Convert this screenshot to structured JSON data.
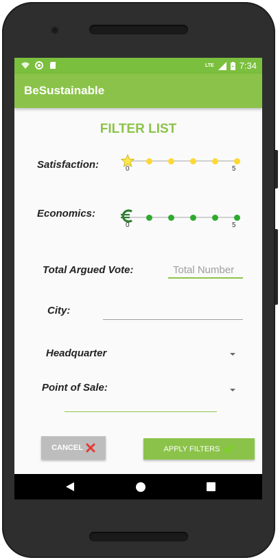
{
  "status_bar": {
    "network_label": "LTE",
    "time": "7:34"
  },
  "app_bar": {
    "title": "BeSustainable"
  },
  "filter": {
    "heading": "FILTER LIST",
    "satisfaction": {
      "label": "Satisfaction:",
      "min_label": "0",
      "max_label": "5",
      "value": 0,
      "steps": 6,
      "thumb_icon": "star-icon",
      "dot_color": "#fdd835"
    },
    "economics": {
      "label": "Economics:",
      "min_label": "0",
      "max_label": "5",
      "value": 0,
      "steps": 6,
      "thumb_icon": "euro-icon",
      "dot_color": "#2eaa2e"
    },
    "total_argued_vote": {
      "label": "Total Argued Vote:",
      "placeholder": "Total Number",
      "value": ""
    },
    "city": {
      "label": "City:",
      "value": ""
    },
    "headquarter": {
      "label": "Headquarter",
      "selected": ""
    },
    "point_of_sale": {
      "label": "Point of Sale:",
      "selected": ""
    }
  },
  "buttons": {
    "cancel_label": "CANCEL",
    "cancel_icon": "cross-icon",
    "apply_label": "APPLY FILTERS",
    "apply_icon": "check-icon"
  },
  "colors": {
    "primary": "#8bc34a",
    "status_bar": "#7bbf3e",
    "cancel_button": "#bdbdbd",
    "apply_button": "#8bc34a",
    "cross": "#e53935",
    "check": "#7bd321"
  },
  "nav_bar": {
    "items": [
      "back-icon",
      "home-icon",
      "recents-icon"
    ]
  }
}
